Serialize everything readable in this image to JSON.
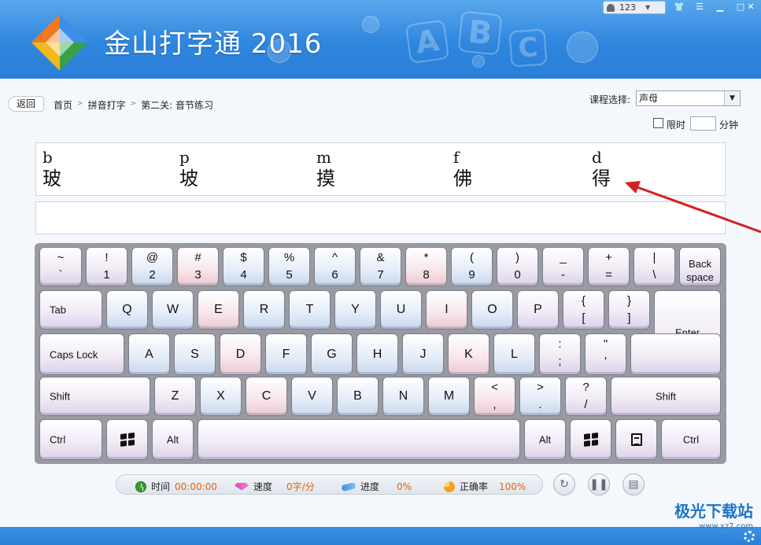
{
  "app": {
    "title": "金山打字通 2016",
    "user": "123",
    "watermark": "极光下载站",
    "watermark_url": "www.xz7.com"
  },
  "toolbar": {
    "back_label": "返回",
    "breadcrumb": [
      "首页",
      "拼音打字",
      "第二关: 音节练习"
    ],
    "course_label": "课程选择:",
    "course_value": "声母",
    "limit_label": "限时",
    "limit_unit": "分钟"
  },
  "practice": {
    "items": [
      {
        "pinyin": "b",
        "char": "玻"
      },
      {
        "pinyin": "p",
        "char": "坡"
      },
      {
        "pinyin": "m",
        "char": "摸"
      },
      {
        "pinyin": "f",
        "char": "佛"
      },
      {
        "pinyin": "d",
        "char": "得"
      }
    ]
  },
  "keyboard": {
    "row1": [
      {
        "top": "~",
        "bot": "`"
      },
      {
        "top": "!",
        "bot": "1"
      },
      {
        "top": "@",
        "bot": "2"
      },
      {
        "top": "#",
        "bot": "3"
      },
      {
        "top": "$",
        "bot": "4"
      },
      {
        "top": "%",
        "bot": "5"
      },
      {
        "top": "^",
        "bot": "6"
      },
      {
        "top": "&",
        "bot": "7"
      },
      {
        "top": "*",
        "bot": "8"
      },
      {
        "top": "(",
        "bot": "9"
      },
      {
        "top": ")",
        "bot": "0"
      },
      {
        "top": "_",
        "bot": "-"
      },
      {
        "top": "+",
        "bot": "="
      },
      {
        "top": "|",
        "bot": "\\"
      }
    ],
    "backspace": "Back space",
    "tab": "Tab",
    "row2": [
      "Q",
      "W",
      "E",
      "R",
      "T",
      "Y",
      "U",
      "I",
      "O",
      "P"
    ],
    "row2_br1": {
      "top": "{",
      "bot": "["
    },
    "row2_br2": {
      "top": "}",
      "bot": "]"
    },
    "enter": "Enter",
    "caps": "Caps Lock",
    "row3": [
      "A",
      "S",
      "D",
      "F",
      "G",
      "H",
      "J",
      "K",
      "L"
    ],
    "row3_p1": {
      "top": ":",
      "bot": ";"
    },
    "row3_p2": {
      "top": "\"",
      "bot": "'"
    },
    "shift": "Shift",
    "row4": [
      "Z",
      "X",
      "C",
      "V",
      "B",
      "N",
      "M"
    ],
    "row4_p1": {
      "top": "<",
      "bot": ","
    },
    "row4_p2": {
      "top": ">",
      "bot": "."
    },
    "row4_p3": {
      "top": "?",
      "bot": "/"
    },
    "ctrl": "Ctrl",
    "alt": "Alt"
  },
  "status": {
    "time_label": "时间",
    "time_value": "00:00:00",
    "speed_label": "速度",
    "speed_value": "0字/分",
    "progress_label": "进度",
    "progress_value": "0%",
    "accuracy_label": "正确率",
    "accuracy_value": "100%"
  },
  "colors": {
    "header": "#2f86de",
    "accent": "#e2650a",
    "annotation": "#d42020"
  }
}
